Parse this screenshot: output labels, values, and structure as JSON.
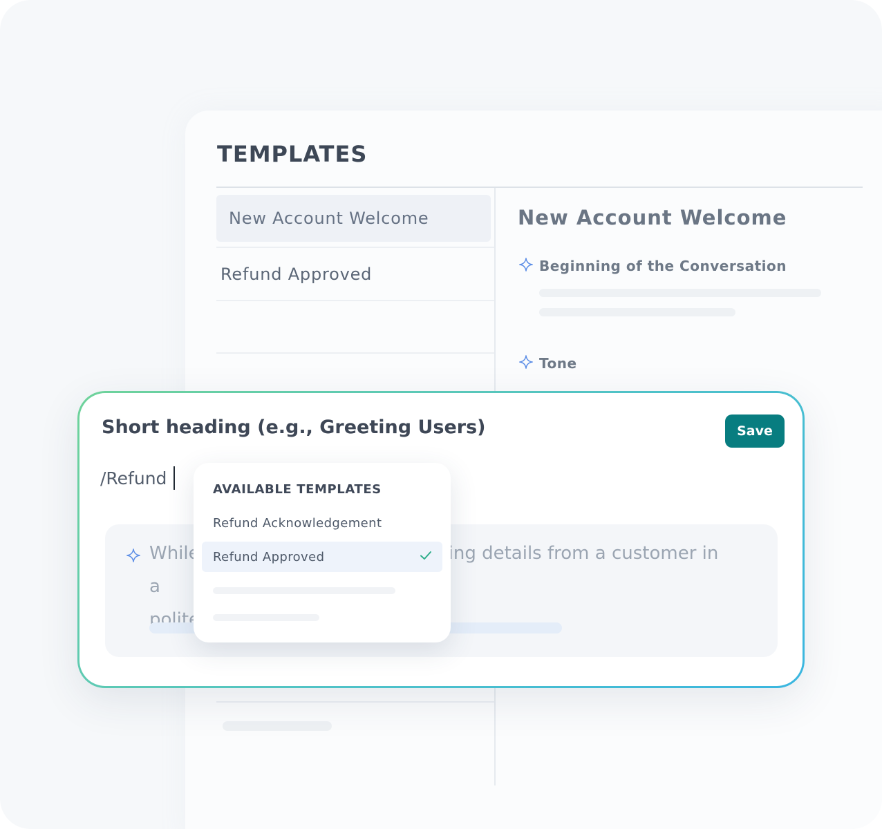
{
  "templates_panel": {
    "title": "TEMPLATES",
    "items": [
      {
        "label": "New Account Welcome",
        "selected": true
      },
      {
        "label": "Refund Approved",
        "selected": false
      }
    ],
    "detail": {
      "title": "New Account Welcome",
      "sections": [
        {
          "label": "Beginning of the Conversation",
          "icon": "sparkle-icon"
        },
        {
          "label": "Tone",
          "icon": "sparkle-icon"
        }
      ]
    }
  },
  "editor": {
    "heading_placeholder": "Short heading (e.g., Greeting Users)",
    "save_label": "Save",
    "input_value": "/Refund",
    "ai_prompt_visible_left_1": "While",
    "ai_prompt_visible_right_1": "ing details from a customer in a",
    "ai_prompt_visible_left_2": "polite",
    "ai_icon": "sparkle-icon"
  },
  "dropdown": {
    "title": "AVAILABLE TEMPLATES",
    "options": [
      {
        "label": "Refund Acknowledgement",
        "selected": false
      },
      {
        "label": "Refund Approved",
        "selected": true
      }
    ],
    "selected_icon": "check-icon"
  },
  "colors": {
    "accent": "#087d80",
    "border_gradient_start": "#6fd39a",
    "border_gradient_end": "#3ab6e0",
    "sparkle": "#5b8de6",
    "check": "#2fae8c"
  }
}
